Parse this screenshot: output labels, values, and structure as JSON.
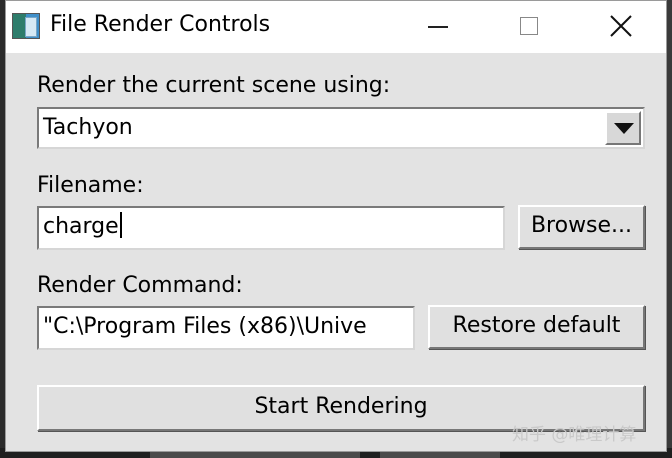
{
  "window": {
    "title": "File Render Controls",
    "icon": "vmd-app-icon",
    "controls": [
      "minimize-icon",
      "maximize-icon",
      "close-icon"
    ]
  },
  "renderer": {
    "label": "Render the current scene using:",
    "selected": "Tachyon"
  },
  "filename": {
    "label": "Filename:",
    "value": "charge",
    "browse_label": "Browse..."
  },
  "command": {
    "label": "Render Command:",
    "value": "\"C:\\Program Files (x86)\\Unive",
    "restore_label": "Restore default"
  },
  "start_label": "Start Rendering",
  "watermark": "知乎 @唯理计算"
}
